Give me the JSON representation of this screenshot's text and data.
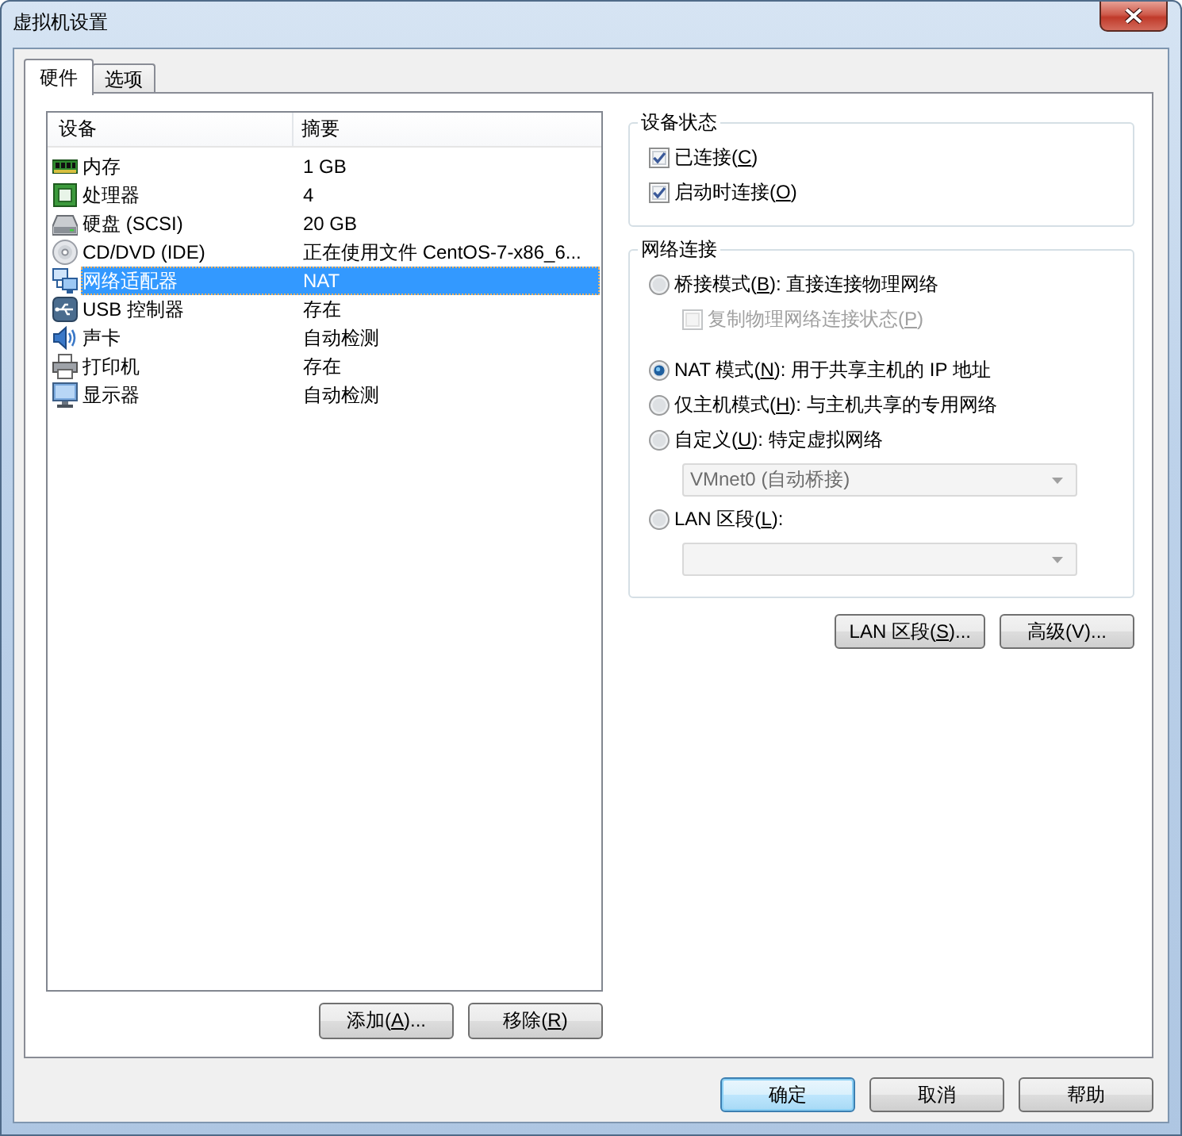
{
  "window": {
    "title": "虚拟机设置"
  },
  "tabs": [
    {
      "label": "硬件",
      "selected": true
    },
    {
      "label": "选项",
      "selected": false
    }
  ],
  "device_list": {
    "columns": [
      "设备",
      "摘要"
    ],
    "rows": [
      {
        "kind": "memory",
        "device": "内存",
        "summary": "1 GB",
        "selected": false
      },
      {
        "kind": "processor",
        "device": "处理器",
        "summary": "4",
        "selected": false
      },
      {
        "kind": "hard_disk",
        "device": "硬盘 (SCSI)",
        "summary": "20 GB",
        "selected": false
      },
      {
        "kind": "cd_dvd",
        "device": "CD/DVD (IDE)",
        "summary": "正在使用文件 CentOS-7-x86_6...",
        "selected": false
      },
      {
        "kind": "network",
        "device": "网络适配器",
        "summary": "NAT",
        "selected": true
      },
      {
        "kind": "usb",
        "device": "USB 控制器",
        "summary": "存在",
        "selected": false
      },
      {
        "kind": "sound",
        "device": "声卡",
        "summary": "自动检测",
        "selected": false
      },
      {
        "kind": "printer",
        "device": "打印机",
        "summary": "存在",
        "selected": false
      },
      {
        "kind": "display",
        "device": "显示器",
        "summary": "自动检测",
        "selected": false
      }
    ]
  },
  "list_buttons": [
    {
      "label": "添加(",
      "access_key": "A",
      "label_rest": ")..."
    },
    {
      "label": "移除(",
      "access_key": "R",
      "label_rest": ")"
    }
  ],
  "device_status": {
    "title": "设备状态",
    "options": [
      {
        "label": "已连接(",
        "access_key": "C",
        "label_rest": ")",
        "checked": true
      },
      {
        "label": "启动时连接(",
        "access_key": "O",
        "label_rest": ")",
        "checked": true
      }
    ]
  },
  "network_connection": {
    "title": "网络连接",
    "options": [
      {
        "label": "桥接模式(",
        "access_key": "B",
        "label_rest": "): 直接连接物理网络",
        "selected": false,
        "children": [
          {
            "kind": "checkbox",
            "label": "复制物理网络连接状态(",
            "access_key": "P",
            "label_rest": ")",
            "checked": false,
            "disabled": true
          }
        ]
      },
      {
        "label": "NAT 模式(",
        "access_key": "N",
        "label_rest": "): 用于共享主机的 IP 地址",
        "selected": true
      },
      {
        "label": "仅主机模式(",
        "access_key": "H",
        "label_rest": "): 与主机共享的专用网络",
        "selected": false
      },
      {
        "label": "自定义(",
        "access_key": "U",
        "label_rest": "): 特定虚拟网络",
        "selected": false,
        "children": [
          {
            "kind": "dropdown",
            "value": "VMnet0 (自动桥接)",
            "disabled": true
          }
        ]
      },
      {
        "label": "LAN 区段(",
        "access_key": "L",
        "label_rest": "):",
        "selected": false,
        "children": [
          {
            "kind": "dropdown",
            "disabled": true
          }
        ]
      }
    ]
  },
  "network_buttons": [
    {
      "label": "LAN 区段(",
      "access_key": "S",
      "label_rest": ")..."
    },
    {
      "label": "高级(V)..."
    }
  ],
  "dialog_buttons": [
    {
      "label": "确定",
      "default": true
    },
    {
      "label": "取消",
      "default": false
    },
    {
      "label": "帮助",
      "default": false
    }
  ]
}
